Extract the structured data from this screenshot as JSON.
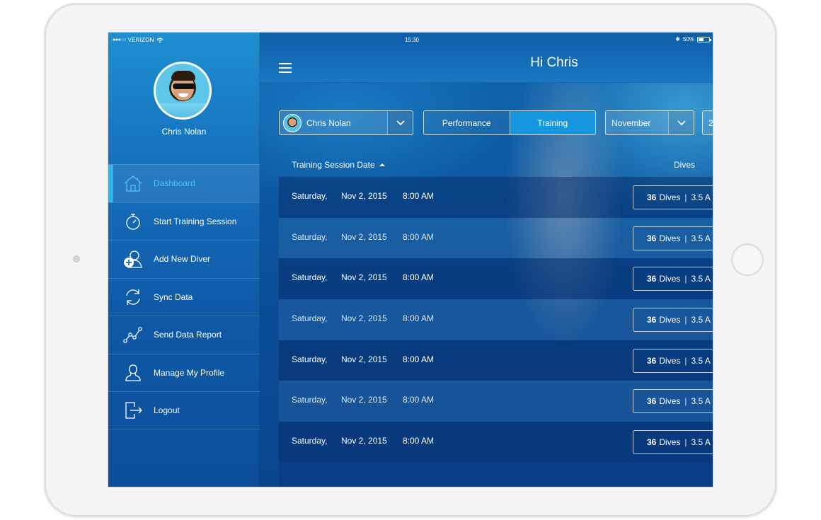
{
  "status_bar": {
    "signal": "●●●○○",
    "carrier": "VERIZON",
    "time": "15:30",
    "bluetooth": "✱",
    "battery_percent": "50%",
    "battery_level": 0.5
  },
  "profile": {
    "name": "Chris Nolan"
  },
  "sidebar": {
    "items": [
      {
        "label": "Dashboard",
        "icon": "home-icon",
        "active": true
      },
      {
        "label": "Start Training Session",
        "icon": "stopwatch-icon",
        "active": false
      },
      {
        "label": "Add New Diver",
        "icon": "add-user-icon",
        "active": false
      },
      {
        "label": "Sync Data",
        "icon": "sync-icon",
        "active": false
      },
      {
        "label": "Send Data Report",
        "icon": "chart-line-icon",
        "active": false
      },
      {
        "label": "Manage My Profile",
        "icon": "user-icon",
        "active": false
      },
      {
        "label": "Logout",
        "icon": "logout-icon",
        "active": false
      }
    ]
  },
  "header": {
    "title": "Hi Chris"
  },
  "filters": {
    "diver": "Chris Nolan",
    "tabs": [
      {
        "label": "Performance",
        "active": false
      },
      {
        "label": "Training",
        "active": true
      }
    ],
    "month": "November",
    "year_partial": "2"
  },
  "table": {
    "columns": {
      "date": "Training Session Date",
      "dives": "Dives"
    },
    "rows": [
      {
        "day": "Saturday,",
        "date": "Nov 2, 2015",
        "time": "8:00 AM",
        "dives_count": "36",
        "dives_label": "Dives",
        "separator": "|",
        "avg": "3.5 A"
      },
      {
        "day": "Saturday,",
        "date": "Nov 2, 2015",
        "time": "8:00 AM",
        "dives_count": "36",
        "dives_label": "Dives",
        "separator": "|",
        "avg": "3.5 A"
      },
      {
        "day": "Saturday,",
        "date": "Nov 2, 2015",
        "time": "8:00 AM",
        "dives_count": "36",
        "dives_label": "Dives",
        "separator": "|",
        "avg": "3.5 A"
      },
      {
        "day": "Saturday,",
        "date": "Nov 2, 2015",
        "time": "8:00 AM",
        "dives_count": "36",
        "dives_label": "Dives",
        "separator": "|",
        "avg": "3.5 A"
      },
      {
        "day": "Saturday,",
        "date": "Nov 2, 2015",
        "time": "8:00 AM",
        "dives_count": "36",
        "dives_label": "Dives",
        "separator": "|",
        "avg": "3.5 A"
      },
      {
        "day": "Saturday,",
        "date": "Nov 2, 2015",
        "time": "8:00 AM",
        "dives_count": "36",
        "dives_label": "Dives",
        "separator": "|",
        "avg": "3.5 A"
      },
      {
        "day": "Saturday,",
        "date": "Nov 2, 2015",
        "time": "8:00 AM",
        "dives_count": "36",
        "dives_label": "Dives",
        "separator": "|",
        "avg": "3.5 A"
      }
    ]
  },
  "colors": {
    "accent": "#2cb5ef",
    "active_tab": "#1796e0",
    "sidebar_top": "#1e8fd0",
    "sidebar_bottom": "#0c4d99"
  }
}
